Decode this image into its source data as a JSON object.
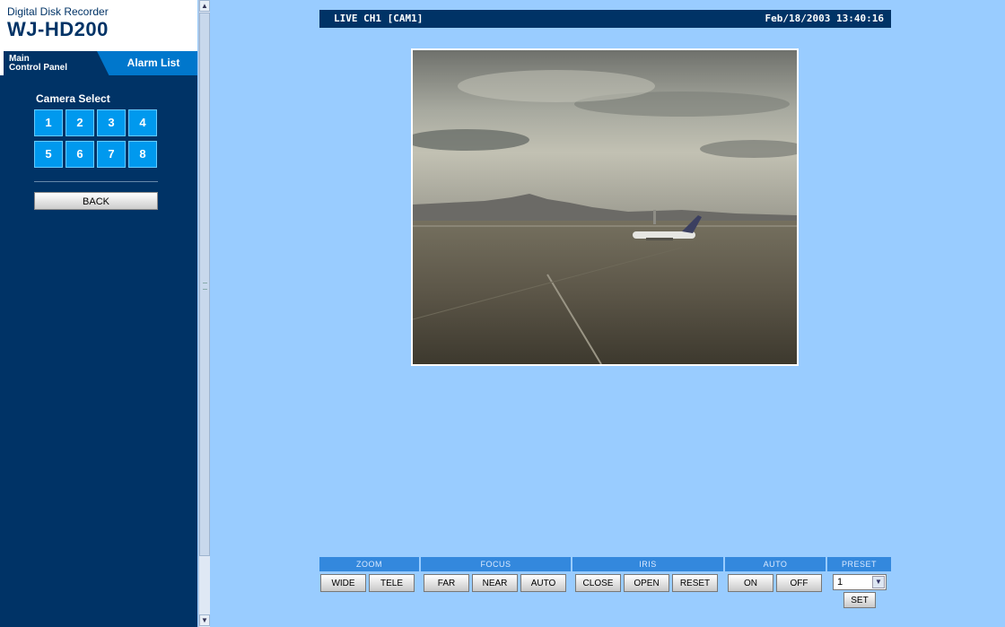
{
  "brand": {
    "subtitle": "Digital Disk Recorder",
    "model": "WJ-HD200"
  },
  "tabs": {
    "main_line1": "Main",
    "main_line2": "Control Panel",
    "alarm": "Alarm List"
  },
  "camera_select": {
    "title": "Camera Select",
    "cameras": [
      "1",
      "2",
      "3",
      "4",
      "5",
      "6",
      "7",
      "8"
    ]
  },
  "back_label": "BACK",
  "header": {
    "channel": "LIVE CH1 [CAM1]",
    "datetime": "Feb/18/2003 13:40:16"
  },
  "controls": {
    "zoom": {
      "label": "ZOOM",
      "wide": "WIDE",
      "tele": "TELE"
    },
    "focus": {
      "label": "FOCUS",
      "far": "FAR",
      "near": "NEAR",
      "auto": "AUTO"
    },
    "iris": {
      "label": "IRIS",
      "close": "CLOSE",
      "open": "OPEN",
      "reset": "RESET"
    },
    "auto": {
      "label": "AUTO",
      "on": "ON",
      "off": "OFF"
    },
    "preset": {
      "label": "PRESET",
      "selected": "1",
      "set": "SET"
    }
  },
  "colors": {
    "panel": "#003366",
    "accent": "#0099ee",
    "page_bg": "#99ccff",
    "group_header": "#3388dd"
  },
  "icons": {
    "scroll_up": "scroll-up-arrow-icon",
    "scroll_down": "scroll-down-arrow-icon",
    "dropdown": "chevron-down-icon"
  }
}
